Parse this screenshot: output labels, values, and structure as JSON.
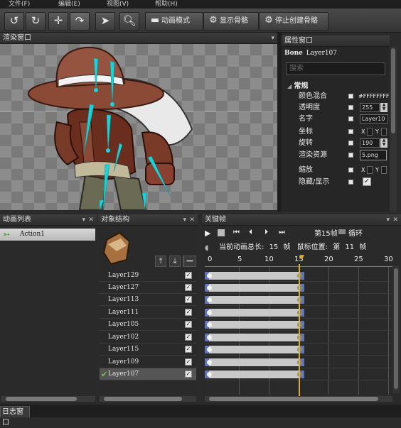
{
  "menu": [
    "文件(F)",
    "编辑(E)",
    "视图(V)",
    "帮助(H)"
  ],
  "toolbar": {
    "animation_mode": "动画模式",
    "show_bones": "显示骨骼",
    "stop_create_bones": "停止创建骨骼"
  },
  "panels": {
    "render": "渲染窗口",
    "properties": "属性窗口",
    "animation_list": "动画列表",
    "object_structure": "对象结构",
    "keyframes": "关键帧",
    "log": "日志窗口"
  },
  "properties": {
    "bone_prefix": "Bone",
    "bone_name": "Layer107",
    "search_placeholder": "搜索",
    "section": "常规",
    "rows": [
      {
        "label": "颜色混合",
        "value": "#FFFFFFFF"
      },
      {
        "label": "透明度",
        "value": "255"
      },
      {
        "label": "名字",
        "value": "Layer10"
      },
      {
        "label": "坐标",
        "x": "X",
        "y": "Y"
      },
      {
        "label": "旋转",
        "value": "190"
      },
      {
        "label": "渲染资源",
        "value": "5.png"
      },
      {
        "label": "缩放",
        "x": "X",
        "y": "Y"
      },
      {
        "label": "隐藏/显示"
      }
    ]
  },
  "animation_list": {
    "items": [
      "Action1"
    ]
  },
  "object_structure": {
    "layers": [
      "Layer129",
      "Layer127",
      "Layer113",
      "Layer111",
      "Layer105",
      "Layer102",
      "Layer115",
      "Layer109",
      "Layer107"
    ],
    "selected": "Layer107"
  },
  "keyframes": {
    "current_frame": "第15帧",
    "loop": "循环",
    "total_label": "当前动画总长:",
    "total_value": "15",
    "frame_unit": "帧",
    "mouse_label": "鼠标位置:",
    "mouse_prefix": "第",
    "mouse_value": "11",
    "mouse_suffix": "帧",
    "ruler": [
      "0",
      "5",
      "10",
      "15",
      "20",
      "25",
      "30"
    ],
    "playhead_frame": 15
  },
  "colors": {
    "bone": "#19d3d8",
    "playhead": "#e0b020",
    "keyframe_cap": "#6474b8"
  }
}
